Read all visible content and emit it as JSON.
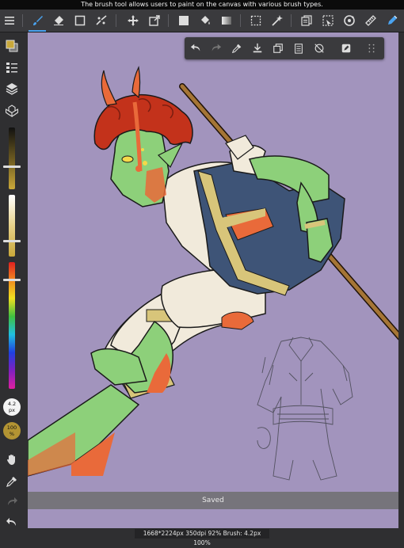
{
  "tooltip": {
    "text": "The brush tool allows users to paint on the canvas with various brush types."
  },
  "toolbar": {
    "tools": [
      {
        "icon": "menu-icon",
        "name": "menu"
      },
      {
        "icon": "brush-icon",
        "name": "brush"
      },
      {
        "icon": "eraser-icon",
        "name": "eraser"
      },
      {
        "icon": "shape-icon",
        "name": "shape"
      },
      {
        "icon": "lasso-fill-icon",
        "name": "lasso-fill"
      },
      {
        "icon": "move-icon",
        "name": "move"
      },
      {
        "icon": "transform-icon",
        "name": "transform"
      },
      {
        "icon": "fill-color-icon",
        "name": "fill-color"
      },
      {
        "icon": "bucket-icon",
        "name": "bucket"
      },
      {
        "icon": "gradient-icon",
        "name": "gradient"
      },
      {
        "icon": "select-icon",
        "name": "select"
      },
      {
        "icon": "magic-wand-icon",
        "name": "magic-wand"
      },
      {
        "icon": "copy-layers-icon",
        "name": "copy-layers"
      },
      {
        "icon": "selection-layer-icon",
        "name": "selection-layer"
      },
      {
        "icon": "rotate-view-icon",
        "name": "rotate-view"
      },
      {
        "icon": "ruler-icon",
        "name": "ruler"
      },
      {
        "icon": "pen-tool-icon",
        "name": "pen-tool"
      }
    ],
    "active_tool": "brush"
  },
  "quickbar": {
    "buttons": [
      "undo-icon",
      "redo-icon",
      "eyedropper-icon",
      "download-icon",
      "duplicate-icon",
      "paste-icon",
      "no-snap-icon",
      "edit-icon",
      "grid-icon"
    ]
  },
  "sidebar": {
    "colors": {
      "primary": "#c9a83a",
      "secondary": "#3a3a3d"
    },
    "brush_size": {
      "value": "4.2",
      "unit": "px"
    },
    "opacity": {
      "value": "100",
      "unit": "%"
    }
  },
  "toast": {
    "text": "Saved"
  },
  "status": {
    "text": "1668*2224px 350dpi 92% Brush: 4.2px 100%"
  },
  "colors": {
    "canvas_bg": "#a294bd",
    "accent": "#4aa3f0"
  }
}
